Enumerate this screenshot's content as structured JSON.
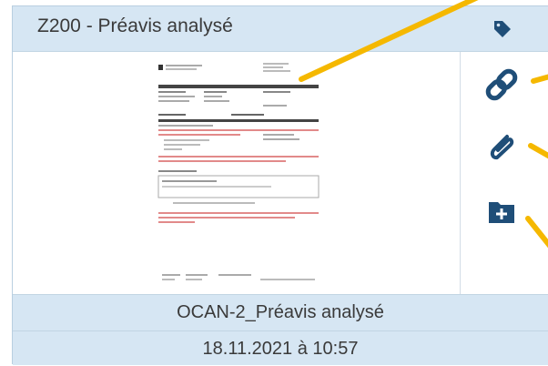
{
  "card": {
    "title": "Z200 - Préavis analysé",
    "document_name": "OCAN-2_Préavis analysé",
    "date": "18.11.2021 à 10:57"
  },
  "icons": {
    "tag": "tag-icon",
    "link": "link-icon",
    "attachment": "paperclip-icon",
    "add_folder": "folder-plus-icon"
  },
  "colors": {
    "header_bg": "#d6e6f3",
    "icon": "#1f4e78",
    "annotation": "#f5b800"
  }
}
